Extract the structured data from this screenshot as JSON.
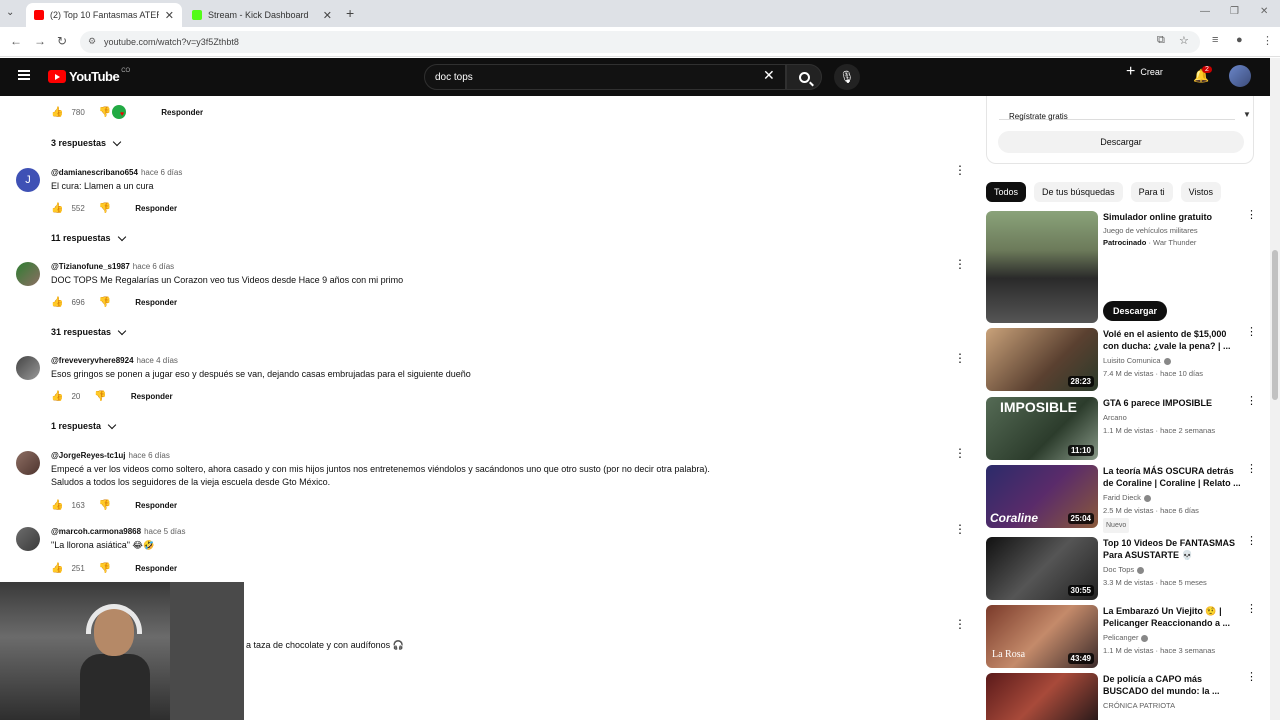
{
  "browser": {
    "tabs": [
      {
        "title": "(2) Top 10 Fantasmas ATERRAD",
        "color": "#ff0000",
        "active": true
      },
      {
        "title": "Stream - Kick Dashboard",
        "color": "#53fc18",
        "active": false
      }
    ],
    "url": "youtube.com/watch?v=y3f5Zthbt8"
  },
  "header": {
    "logo": "YouTube",
    "region": "CO",
    "search_value": "doc tops",
    "create_label": "Crear",
    "notif_count": "2"
  },
  "comments": [
    {
      "likes": "780",
      "reply": "Responder",
      "replies": "3 respuestas"
    },
    {
      "initial": "J",
      "avatar_color": "#3f51b5",
      "author": "@damianescribano654",
      "time": "hace 6 días",
      "text": "El cura: Llamen a un cura",
      "likes": "552",
      "reply": "Responder",
      "replies": "11 respuestas"
    },
    {
      "author": "@Tizianofune_s1987",
      "time": "hace 6 días",
      "text": "DOC TOPS Me Regalarías un Corazon veo tus Videos desde Hace 9 años con mi primo",
      "likes": "696",
      "reply": "Responder",
      "replies": "31 respuestas"
    },
    {
      "author": "@freveveryvhere8924",
      "time": "hace 4 días",
      "text": "Esos gringos se ponen a jugar eso y después se van, dejando casas embrujadas para el siguiente dueño",
      "likes": "20",
      "reply": "Responder",
      "replies": "1 respuesta"
    },
    {
      "author": "@JorgeReyes-tc1uj",
      "time": "hace 6 días",
      "text": "Empecé a ver los videos como soltero, ahora casado y con mis hijos juntos nos entretenemos viéndolos y sacándonos uno que otro susto (por no decir otra palabra).\nSaludos a todos los seguidores de la vieja escuela desde Gto México.",
      "likes": "163",
      "reply": "Responder"
    },
    {
      "author": "@marcoh.carmona9868",
      "time": "hace 5 días",
      "text": "\"La llorona asiática\" 😂🤣",
      "likes": "251",
      "reply": "Responder"
    }
  ],
  "below_cam_text": "a taza de chocolate y con audífonos 🎧",
  "sidebar": {
    "ad_register": "Regístrate gratis",
    "ad_download": "Descargar",
    "chips": [
      "Todos",
      "De tus búsquedas",
      "Para ti",
      "Vistos"
    ],
    "ad": {
      "title": "Simulador online gratuito",
      "sub": "Juego de vehículos militares",
      "sponsored": "Patrocinado",
      "brand": "· War Thunder",
      "cta": "Descargar"
    },
    "videos": [
      {
        "title": "Volé en el asiento de $15,000 con ducha: ¿vale la pena? | ...",
        "channel": "Luisito Comunica",
        "stats": "7.4 M de vistas · hace 10 días",
        "duration": "28:23",
        "thumb": "linear-gradient(135deg,#c9a27a,#5a4030 60%,#2a3a2a)"
      },
      {
        "title": "GTA 6 parece IMPOSIBLE",
        "channel": "Arcano",
        "stats": "1.1 M de vistas · hace 2 semanas",
        "duration": "11:10",
        "thumb": "linear-gradient(135deg,#556b55,#2c3c2c 60%,#889988)",
        "overlay": "IMPOSIBLE"
      },
      {
        "title": "La teoría MÁS OSCURA detrás de Coraline | Coraline | Relato ...",
        "channel": "Farid Dieck",
        "stats": "2.5 M de vistas · hace 6 días",
        "duration": "25:04",
        "thumb": "linear-gradient(135deg,#2b2b6a,#5a2b6a 50%,#8a5a3a)",
        "badge": "Nuevo",
        "overlay": "Coraline"
      },
      {
        "title": "Top 10 Videos De FANTASMAS Para ASUSTARTE 💀",
        "channel": "Doc Tops",
        "stats": "3.3 M de vistas · hace 5 meses",
        "duration": "30:55",
        "thumb": "linear-gradient(135deg,#111,#555 50%,#222)"
      },
      {
        "title": "La Embarazó Un Viejito 🤨 | Pelicanger Reaccionando a ...",
        "channel": "Pelicanger",
        "stats": "1.1 M de vistas · hace 3 semanas",
        "duration": "43:49",
        "thumb": "linear-gradient(135deg,#7a3a2a,#c48a6a 50%,#3a2a2a)",
        "overlay": "La Rosa"
      },
      {
        "title": "De policía a CAPO más BUSCADO del mundo: la ...",
        "channel": "CRÓNICA PATRIOTA",
        "thumb": "linear-gradient(135deg,#5a1a1a,#a84a3a 50%,#2a1a1a)"
      }
    ]
  }
}
